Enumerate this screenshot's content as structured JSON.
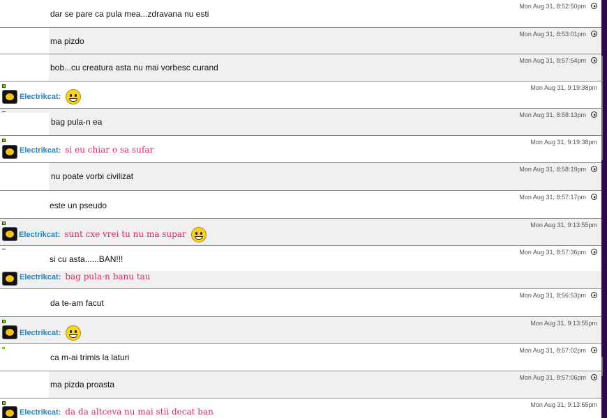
{
  "messages": [
    {
      "text": "dar se pare ca pula mea...zdravana nu esti",
      "time": "Mon Aug 31, 8:52:50pm"
    },
    {
      "text": "ma pizdo",
      "time": "Mon Aug 31, 8:53:01pm"
    },
    {
      "text": "bob...cu  creatura asta nu mai vorbesc curand",
      "time": "Mon Aug 31, 8:57:54pm"
    },
    {
      "user": "Electrikcat:",
      "text": "",
      "time": "Mon Aug 31, 9:19:38pm"
    },
    {
      "text": "bag pula-n ea",
      "time": "Mon Aug 31, 8:58:13pm"
    },
    {
      "user": "Electrikcat:",
      "text": "si eu chiar o sa sufar",
      "time": "Mon Aug 31, 9:19:38pm"
    },
    {
      "text": "nu poate vorbi civilizat",
      "time": "Mon Aug 31, 8:58:19pm"
    },
    {
      "text": "este un pseudo",
      "time": "Mon Aug 31, 8:57:17pm"
    },
    {
      "user": "Electrikcat:",
      "text": "sunt cxe vrei tu nu ma supar",
      "time": "Mon Aug 31, 9:13:55pm"
    },
    {
      "text": "si cu asta......BAN!!!",
      "time": "Mon Aug 31, 8:57:36pm"
    },
    {
      "user": "Electrikcat:",
      "text": "bag pula-n banu tau",
      "time": ""
    },
    {
      "text": "da te-am facut",
      "time": "Mon Aug 31, 8:56:53pm"
    },
    {
      "user": "Electrikcat:",
      "text": "",
      "time": "Mon Aug 31, 9:13:55pm"
    },
    {
      "text": "ca m-ai trimis la laturi",
      "time": "Mon Aug 31, 8:57:02pm"
    },
    {
      "text": "ma pizda proasta",
      "time": "Mon Aug 31, 8:57:06pm"
    },
    {
      "user": "Electrikcat:",
      "text": "da da altceva nu mai stii decat ban",
      "time": "Mon Aug 31, 9:13:55pm"
    }
  ],
  "colors": {
    "username": "#1c86c8",
    "bot_text": "#e0245e",
    "alt_row": "#f0f0f0"
  },
  "icons": {
    "status": "status-online-icon",
    "avatar": "cat-avatar-icon",
    "smiley": "grin-smiley-icon",
    "action": "play-circle-icon"
  }
}
